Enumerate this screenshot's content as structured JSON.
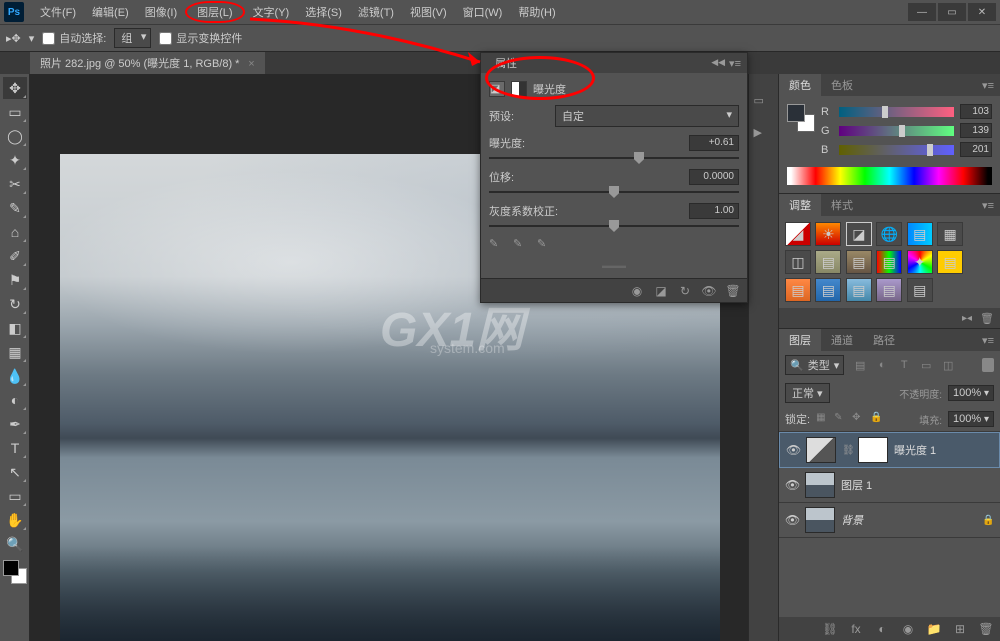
{
  "app": {
    "logo": "Ps"
  },
  "menu": [
    "文件(F)",
    "编辑(E)",
    "图像(I)",
    "图层(L)",
    "文字(Y)",
    "选择(S)",
    "滤镜(T)",
    "视图(V)",
    "窗口(W)",
    "帮助(H)"
  ],
  "menu_highlighted_index": 3,
  "options": {
    "auto_select": "自动选择:",
    "group": "组",
    "show_transform": "显示变换控件"
  },
  "doc_tab": "照片 282.jpg @ 50% (曝光度 1, RGB/8) *",
  "properties": {
    "tab": "属性",
    "adjustment": "曝光度",
    "preset_label": "预设:",
    "preset_value": "自定",
    "exposure": {
      "label": "曝光度:",
      "value": "+0.61",
      "pos": 60
    },
    "offset": {
      "label": "位移:",
      "value": "0.0000",
      "pos": 50
    },
    "gamma": {
      "label": "灰度系数校正:",
      "value": "1.00",
      "pos": 50
    }
  },
  "color_panel": {
    "tab1": "颜色",
    "tab2": "色板",
    "r": {
      "label": "R",
      "value": "103",
      "pos": 40
    },
    "g": {
      "label": "G",
      "value": "139",
      "pos": 55
    },
    "b": {
      "label": "B",
      "value": "201",
      "pos": 79
    }
  },
  "adjust_panel": {
    "tab1": "调整",
    "tab2": "样式"
  },
  "layers_panel": {
    "tab1": "图层",
    "tab2": "通道",
    "tab3": "路径",
    "filter": "类型",
    "blend": "正常",
    "opacity_label": "不透明度:",
    "opacity": "100%",
    "lock_label": "锁定:",
    "fill_label": "填充:",
    "fill": "100%",
    "layers": [
      {
        "name": "曝光度 1",
        "type": "adjustment",
        "selected": true
      },
      {
        "name": "图层 1",
        "type": "image",
        "selected": false
      },
      {
        "name": "背景",
        "type": "image",
        "selected": false,
        "locked": true,
        "italic": true
      }
    ]
  },
  "watermark": {
    "main": "GX1网",
    "sub": "system.com"
  }
}
